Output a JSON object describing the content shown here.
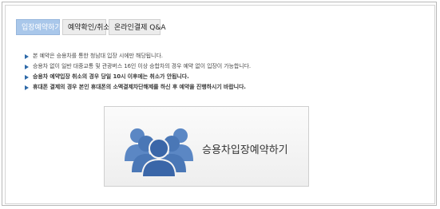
{
  "tabs": [
    {
      "label": "입장예약하기",
      "active": true
    },
    {
      "label": "예약확인/취소",
      "active": false
    },
    {
      "label": "온라인결제 Q&A",
      "active": false
    }
  ],
  "notices": [
    "본 예약은 승용차를 통한 청남대 입장 시에만 해당됩니다.",
    "승용차 없이 일반 대중교통 및 관광버스 16인 이상 승합차의 경우 예약 없이 입장이 가능합니다.",
    "승용차 예약입장 취소의 경우 당일 10시 이후에는 취소가 안됩니다.",
    "휴대폰 결제의 경우 본인 휴대폰의 소액결제차단해제를 하신 후 예약을 진행하시기 바랍니다."
  ],
  "cta": {
    "label": "승용차입장예약하기",
    "icon": "users-group-icon"
  },
  "colors": {
    "active_tab": "#a9c7ea",
    "bullet": "#2d69a8",
    "icon_blue": "#4f7dbd"
  }
}
